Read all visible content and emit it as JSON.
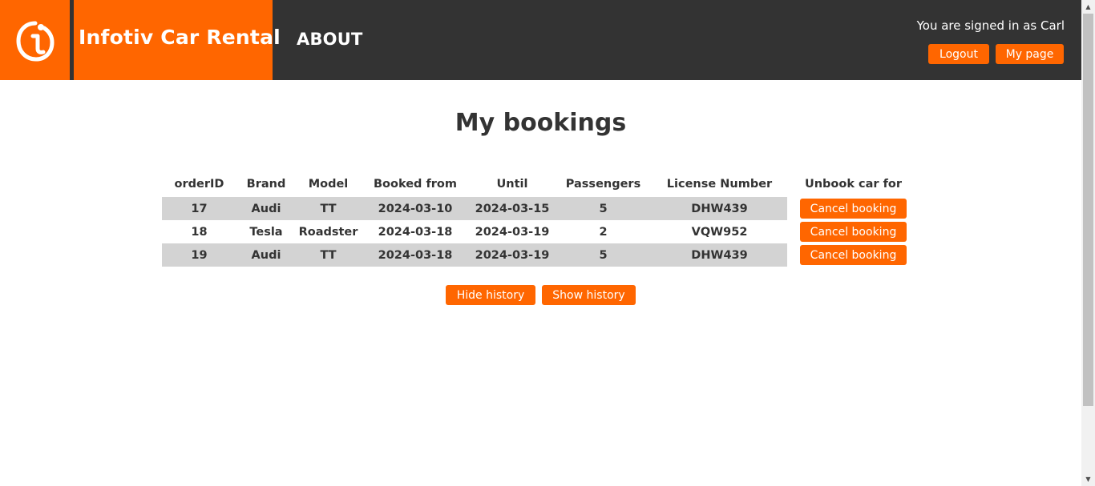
{
  "header": {
    "brand": "Infotiv Car Rental",
    "nav_about": "ABOUT",
    "signed_in_text": "You are signed in as Carl",
    "logout_label": "Logout",
    "mypage_label": "My page",
    "logo_icon": "infotiv-logo-icon"
  },
  "main": {
    "title": "My bookings",
    "table": {
      "columns": [
        "orderID",
        "Brand",
        "Model",
        "Booked from",
        "Until",
        "Passengers",
        "License Number",
        "Unbook car for"
      ],
      "rows": [
        {
          "orderID": "17",
          "brand": "Audi",
          "model": "TT",
          "from": "2024-03-10",
          "until": "2024-03-15",
          "passengers": "5",
          "license": "DHW439",
          "action": "Cancel booking"
        },
        {
          "orderID": "18",
          "brand": "Tesla",
          "model": "Roadster",
          "from": "2024-03-18",
          "until": "2024-03-19",
          "passengers": "2",
          "license": "VQW952",
          "action": "Cancel booking"
        },
        {
          "orderID": "19",
          "brand": "Audi",
          "model": "TT",
          "from": "2024-03-18",
          "until": "2024-03-19",
          "passengers": "5",
          "license": "DHW439",
          "action": "Cancel booking"
        }
      ]
    },
    "hide_history_label": "Hide history",
    "show_history_label": "Show history"
  },
  "colors": {
    "accent": "#ff6600",
    "header_bg": "#333333",
    "row_shade": "#d3d3d3"
  }
}
